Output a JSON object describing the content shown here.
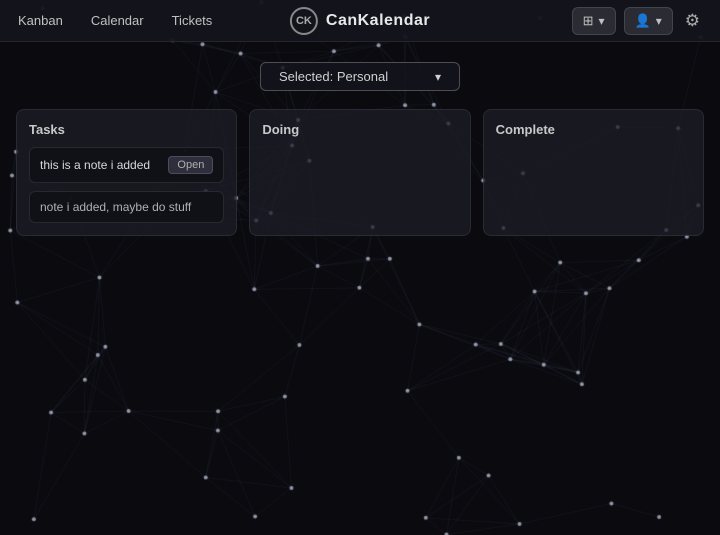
{
  "app": {
    "title": "CanKalendar",
    "brand_icon": "CK"
  },
  "navbar": {
    "links": [
      {
        "label": "Kanban",
        "id": "kanban"
      },
      {
        "label": "Calendar",
        "id": "calendar"
      },
      {
        "label": "Tickets",
        "id": "tickets"
      }
    ],
    "view_toggle_icon": "⊞",
    "user_icon": "👤",
    "gear_icon": "⚙"
  },
  "selector": {
    "label": "Selected: Personal",
    "chevron": "▾"
  },
  "columns": [
    {
      "id": "tasks",
      "title": "Tasks",
      "cards": [
        {
          "title": "this is a note i added",
          "badge": "Open"
        }
      ],
      "notes": [
        {
          "text": "note i added, maybe do stuff"
        }
      ]
    },
    {
      "id": "doing",
      "title": "Doing",
      "cards": [],
      "notes": []
    },
    {
      "id": "complete",
      "title": "Complete",
      "cards": [],
      "notes": []
    }
  ]
}
